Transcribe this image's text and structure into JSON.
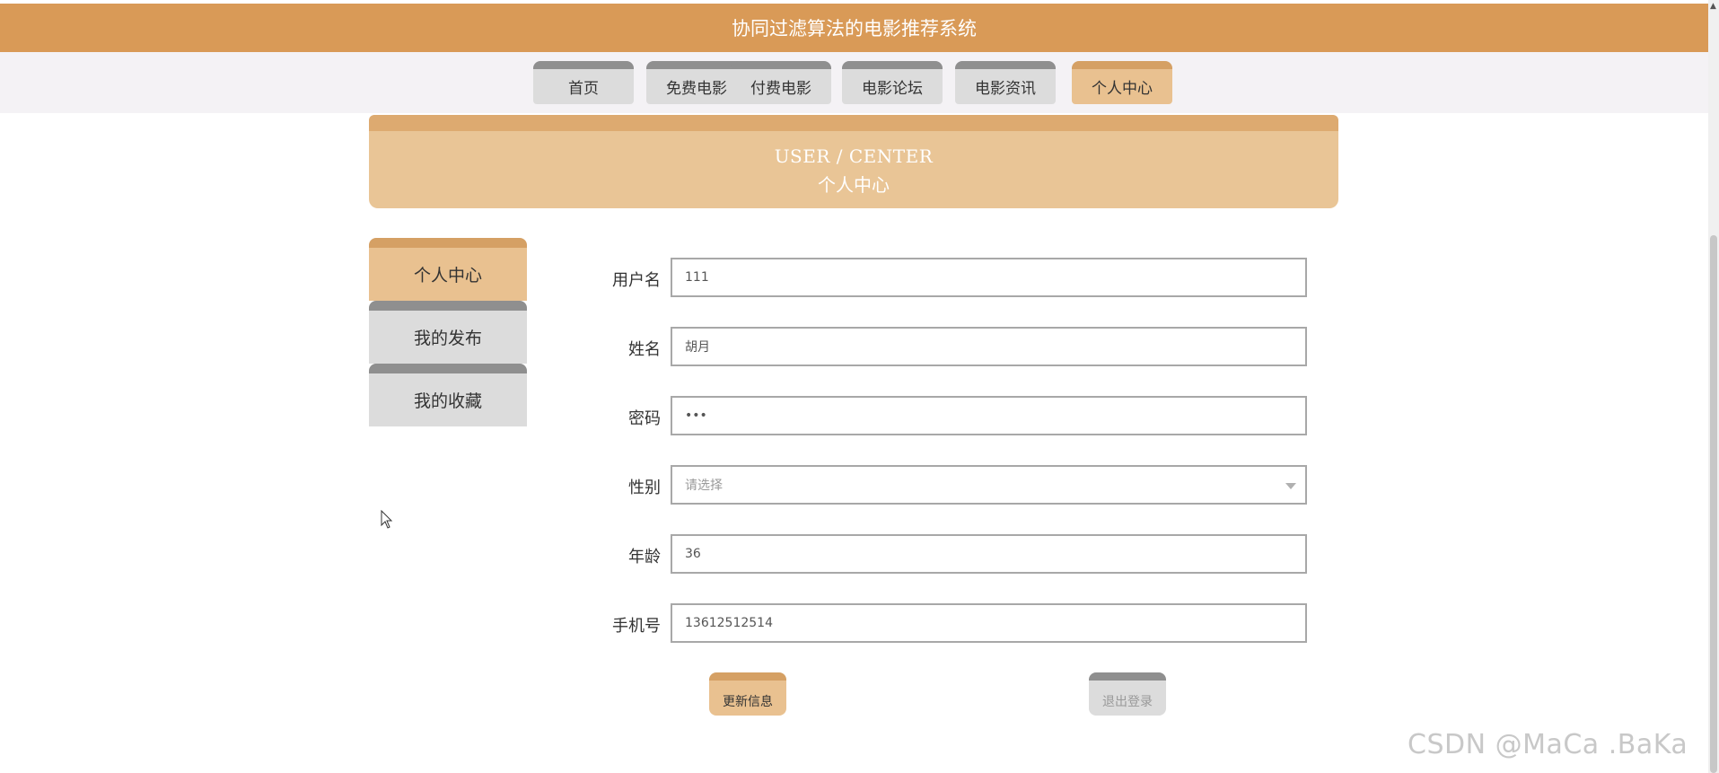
{
  "header": {
    "title": "协同过滤算法的电影推荐系统"
  },
  "nav": {
    "tabs": [
      {
        "label": "首页"
      },
      {
        "label": "免费电影"
      },
      {
        "label": "付费电影"
      },
      {
        "label": "电影论坛"
      },
      {
        "label": "电影资讯"
      },
      {
        "label": "个人中心",
        "active": true
      }
    ]
  },
  "banner": {
    "title_en": "USER / CENTER",
    "title_cn": "个人中心"
  },
  "sidebar": {
    "items": [
      {
        "label": "个人中心",
        "active": true
      },
      {
        "label": "我的发布"
      },
      {
        "label": "我的收藏"
      }
    ]
  },
  "form": {
    "username": {
      "label": "用户名",
      "value": "111"
    },
    "name": {
      "label": "姓名",
      "value": "胡月"
    },
    "password": {
      "label": "密码",
      "value": "•••"
    },
    "gender": {
      "label": "性别",
      "placeholder": "请选择"
    },
    "age": {
      "label": "年龄",
      "value": "36"
    },
    "phone": {
      "label": "手机号",
      "value": "13612512514"
    }
  },
  "buttons": {
    "update": "更新信息",
    "logout": "退出登录"
  },
  "watermark": "CSDN @MaCa .BaKa",
  "colors": {
    "accent": "#d99a57",
    "accent_light": "#e9c190",
    "tab_inactive": "#dcdcdc",
    "tab_inactive_border": "#8f8f8f"
  }
}
